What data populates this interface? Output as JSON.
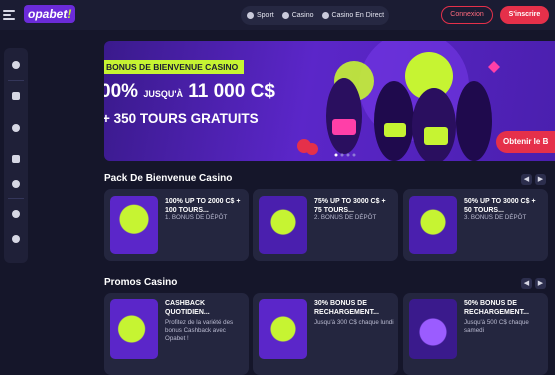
{
  "header": {
    "logo_text": "opabet",
    "logo_bang": "!",
    "nav": [
      {
        "label": "Sport",
        "icon": "soccer-ball-icon"
      },
      {
        "label": "Casino",
        "icon": "casino-chip-icon"
      },
      {
        "label": "Casino En Direct",
        "icon": "live-casino-icon"
      }
    ],
    "login_label": "Connexion",
    "signup_label": "S'inscrire"
  },
  "sidebar": {
    "icons": [
      "live-icon",
      "cards-icon",
      "roulette-icon",
      "promotions-megaphone-icon",
      "user-icon",
      "support-icon",
      "language-globe-icon"
    ]
  },
  "banner": {
    "tag": "BONUS DE BIENVENUE CASINO",
    "line1_big": "00%",
    "line1_small": "JUSQU'À",
    "line1_amount": "11 000 C$",
    "line2": "+ 350 TOURS GRATUITS",
    "cta": "Obtenir le B"
  },
  "welcome_pack": {
    "title": "Pack De Bienvenue Casino",
    "cards": [
      {
        "title": "100% UP TO 2000 C$ + 100 TOURS...",
        "subtitle": "1. BONUS DE DÉPÔT"
      },
      {
        "title": "75% UP TO 3000 C$ + 75 TOURS...",
        "subtitle": "2. BONUS DE DÉPÔT"
      },
      {
        "title": "50% UP TO 3000 C$ + 50 TOURS...",
        "subtitle": "3. BONUS DE DÉPÔT"
      }
    ]
  },
  "promos": {
    "title": "Promos Casino",
    "cards": [
      {
        "title": "CASHBACK QUOTIDIEN...",
        "subtitle": "Profitez de la variété des bonus Cashback avec Opabet !"
      },
      {
        "title": "30% BONUS DE RECHARGEMENT...",
        "subtitle": "Jusqu'à 300 C$ chaque lundi"
      },
      {
        "title": "50% BONUS DE RECHARGEMENT...",
        "subtitle": "Jusqu'à 500 C$ chaque samedi"
      }
    ]
  },
  "colors": {
    "background": "#15162a",
    "accent_red": "#e5304a",
    "accent_lime": "#c6f432",
    "brand_purple": "#6b2bd9"
  }
}
